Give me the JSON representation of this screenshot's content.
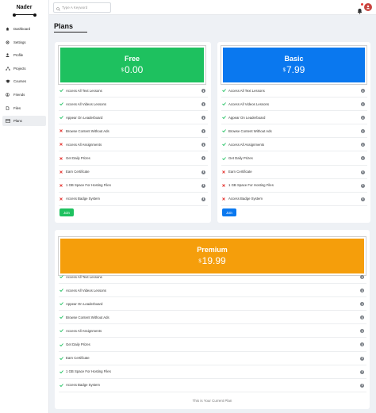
{
  "sidebar": {
    "brand": "Nader",
    "items": [
      {
        "label": "Dashboard",
        "icon": "dashboard-icon"
      },
      {
        "label": "Settings",
        "icon": "gear-icon"
      },
      {
        "label": "Profile",
        "icon": "user-icon"
      },
      {
        "label": "Projects",
        "icon": "projects-icon"
      },
      {
        "label": "Courses",
        "icon": "graduation-cap-icon"
      },
      {
        "label": "Friends",
        "icon": "friends-icon"
      },
      {
        "label": "Files",
        "icon": "file-icon"
      },
      {
        "label": "Plans",
        "icon": "credit-card-icon",
        "active": true
      }
    ]
  },
  "topbar": {
    "search_placeholder": "Type A Keyword",
    "icons": [
      "search-icon",
      "bell-icon",
      "avatar"
    ]
  },
  "page": {
    "title": "Plans"
  },
  "colors": {
    "free": "#1ec15f",
    "basic": "#0a78ef",
    "premium": "#f59e0b",
    "check": "#1ec15f",
    "cross": "#e53935"
  },
  "plans": {
    "free": {
      "name": "Free",
      "currency": "$",
      "price": "0.00",
      "features": [
        {
          "label": "Access All Text Lessons",
          "included": true
        },
        {
          "label": "Access All Videos Lessons",
          "included": true
        },
        {
          "label": "Appear On Leaderboard",
          "included": true
        },
        {
          "label": "Browse Content Without Ads",
          "included": false
        },
        {
          "label": "Access All Assignments",
          "included": false
        },
        {
          "label": "Get Daily Prizes",
          "included": false
        },
        {
          "label": "Earn Certificate",
          "included": false
        },
        {
          "label": "1 GB Space For Hosting Files",
          "included": false
        },
        {
          "label": "Access Badge System",
          "included": false
        }
      ],
      "button": "Join"
    },
    "basic": {
      "name": "Basic",
      "currency": "$",
      "price": "7.99",
      "features": [
        {
          "label": "Access All Text Lessons",
          "included": true
        },
        {
          "label": "Access All Videos Lessons",
          "included": true
        },
        {
          "label": "Appear On Leaderboard",
          "included": true
        },
        {
          "label": "Browse Content Without Ads",
          "included": true
        },
        {
          "label": "Access All Assignments",
          "included": true
        },
        {
          "label": "Get Daily Prizes",
          "included": true
        },
        {
          "label": "Earn Certificate",
          "included": false
        },
        {
          "label": "1 GB Space For Hosting Files",
          "included": false
        },
        {
          "label": "Access Badge System",
          "included": false
        }
      ],
      "button": "Join"
    },
    "premium": {
      "name": "Premium",
      "currency": "$",
      "price": "19.99",
      "features": [
        {
          "label": "Access All Text Lessons",
          "included": true
        },
        {
          "label": "Access All Videos Lessons",
          "included": true
        },
        {
          "label": "Appear On Leaderboard",
          "included": true
        },
        {
          "label": "Browse Content Without Ads",
          "included": true
        },
        {
          "label": "Access All Assignments",
          "included": true
        },
        {
          "label": "Get Daily Prizes",
          "included": true
        },
        {
          "label": "Earn Certificate",
          "included": true
        },
        {
          "label": "1 GB Space For Hosting Files",
          "included": true
        },
        {
          "label": "Access Badge System",
          "included": true
        }
      ],
      "status": "This is Your Current Plan"
    }
  }
}
